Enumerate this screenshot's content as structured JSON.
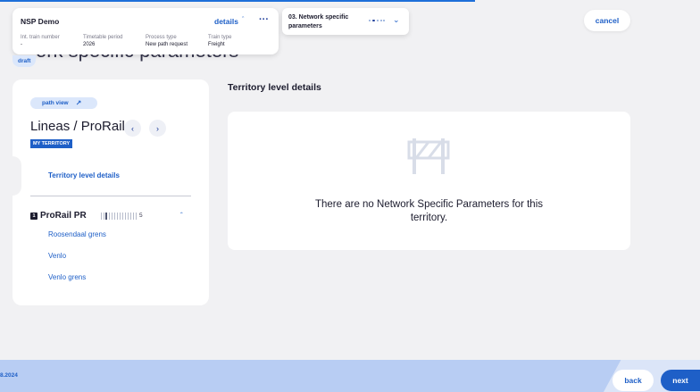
{
  "background_heading": "ork specific parameters",
  "header": {
    "title": "NSP Demo",
    "details_label": "details",
    "caret_icon": "caret-up-icon",
    "more_icon": "more-horizontal-icon",
    "meta": [
      {
        "label": "Int. train number",
        "value": "-"
      },
      {
        "label": "Timetable period",
        "value": "2026"
      },
      {
        "label": "Process type",
        "value": "New path request"
      },
      {
        "label": "Train type",
        "value": "Freight"
      }
    ],
    "status_badge": "draft"
  },
  "step": {
    "label": "03. Network specific parameters",
    "chevron_icon": "chevron-down-icon"
  },
  "cancel_label": "cancel",
  "left_panel": {
    "path_view_label": "path view",
    "path_view_icon": "external-link-icon",
    "title": "Lineas / ProRail",
    "prev_icon": "chevron-left-icon",
    "next_icon": "chevron-right-icon",
    "territory_badge": "MY TERRITORY",
    "territory_link": "Territory level details",
    "section": {
      "number": "1",
      "title": "ProRail PR",
      "count": "5",
      "collapse_icon": "chevron-up-icon",
      "items": [
        "Roosendaal grens",
        "Venlo",
        "Venlo grens"
      ]
    }
  },
  "main": {
    "heading": "Territory level details",
    "empty_icon": "roadblock-icon",
    "empty_message": "There are no Network Specific Parameters for this territory."
  },
  "footer": {
    "date_fragment": "8.2024",
    "back_label": "back",
    "next_label": "next"
  },
  "colors": {
    "accent": "#1e5fc7",
    "background": "#f1f1f3",
    "footer": "#b8cdf3"
  }
}
